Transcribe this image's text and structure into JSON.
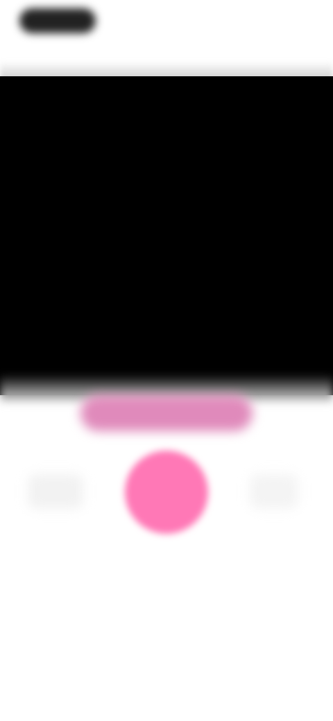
{
  "status_bar": {
    "time": ""
  },
  "camera": {
    "mode_label": ""
  },
  "controls": {
    "gallery_icon": "gallery-icon",
    "shutter_icon": "shutter-icon",
    "switch_camera_icon": "switch-camera-icon"
  },
  "colors": {
    "accent": "#ff78b6",
    "mode_selector": "#e08abb",
    "viewfinder": "#000000",
    "background": "#ffffff"
  }
}
